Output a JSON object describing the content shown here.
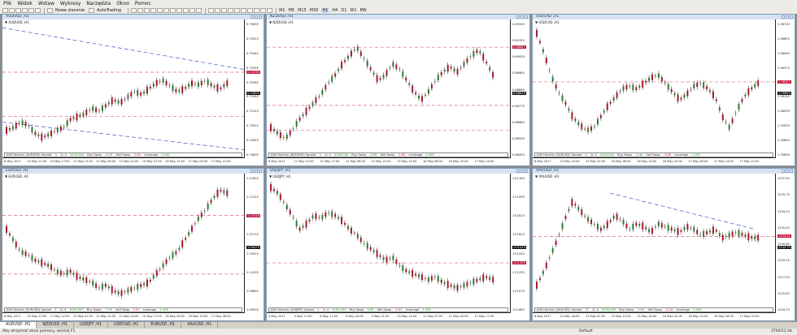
{
  "menu": [
    "Plik",
    "Widok",
    "Wstaw",
    "Wykresy",
    "Narzędzia",
    "Okno",
    "Pomoc"
  ],
  "toolbar": {
    "new_order": "Nowe zlecenie",
    "autotrading": "AutoTrading",
    "timeframes": [
      "M1",
      "M5",
      "M15",
      "M30",
      "H1",
      "H4",
      "D1",
      "W1",
      "MN"
    ],
    "active_timeframe": "H1"
  },
  "charts": [
    {
      "title": "AUDUSD ,H1",
      "symbol": "AUDUSD ,H1",
      "color": "#1a1a1a",
      "axis": [
        "0.75635",
        "0.75515",
        "0.75440",
        "0.75335",
        "0.75285",
        "0.75185",
        "0.75125",
        "0.75025",
        "0.74945",
        "0.74835"
      ],
      "price_tag": "0.74780",
      "price_tag2": "0.74905",
      "times": [
        "8 May 2017",
        "10 May 21:00",
        "10 May 17:00",
        "11 May 13:00",
        "12 May 09:00",
        "15 May 01:00",
        "15 May 21:00",
        "16 May 13:00",
        "17 May 09:00",
        "17 May 21:00"
      ],
      "info": {
        "label": "J&M Hendrix (AUDUSD)",
        "spread_l": "Spread",
        "spread_v": "4",
        "margin_l": "1L 4",
        "margin_v": "$100,000",
        "swap_buy_l": "Buy Swap",
        "swap_buy_v": "-0.25",
        "swap_sell_l": "Sell Swap",
        "swap_sell_v": "-0.20",
        "lev_l": "Leverage",
        "lev_v": "1:100"
      }
    },
    {
      "title": "NZDUSD ,H1",
      "symbol": "NZDUSD ,H1",
      "color": "#1a1a1a",
      "axis": [
        "0.69240",
        "0.69155",
        "0.69050",
        "0.68960",
        "0.68865",
        "0.68775",
        "0.68680",
        "0.68590",
        "0.68495"
      ],
      "price_tag": "0.68847",
      "price_tag2": "0.68610",
      "times": [
        "8 May 2017",
        "11 May 12:00",
        "11 May 17:00",
        "12 May 06:00",
        "12 May 22:00",
        "15 May 14:00",
        "16 May 06:00",
        "16 May 22:00",
        "17 May 14:00"
      ],
      "info": {
        "label": "J&M Hendrix (NZDUSD)",
        "spread_l": "Spread",
        "spread_v": "5",
        "margin_l": "1L 4",
        "margin_v": "$100,000",
        "swap_buy_l": "Buy Swap",
        "swap_buy_v": "-0.05",
        "swap_sell_l": "Sell Swap",
        "swap_sell_v": "-2.62",
        "lev_l": "Leverage",
        "lev_v": "1:100"
      }
    },
    {
      "title": "USDCAD ,H1",
      "symbol": "USDCAD ,H1",
      "color": "#1a1a1a",
      "axis": [
        "1.36720",
        "1.36605",
        "1.36490",
        "1.36375",
        "1.36260",
        "1.36145",
        "1.36035",
        "1.35920",
        "1.35805",
        "1.35690"
      ],
      "price_tag": "1.36357",
      "price_tag2": "1.35655",
      "times": [
        "8 May 2017",
        "15 May 10:00",
        "15 May 22:00",
        "16 May 06:00",
        "16 May 14:00",
        "16 May 22:00",
        "17 May 06:00",
        "17 May 14:00",
        "17 May 22:00"
      ],
      "info": {
        "label": "J&M Hendrix (USDCAD)",
        "spread_l": "Spread",
        "spread_v": "4",
        "margin_l": "1L 4",
        "margin_v": "$100,000",
        "swap_buy_l": "Buy Swap",
        "swap_buy_v": "-0.40",
        "swap_sell_l": "Sell Swap",
        "swap_sell_v": "-3.00",
        "lev_l": "Leverage",
        "lev_v": "1:100"
      }
    },
    {
      "title": "EURUSD ,H1",
      "symbol": "EURUSD ,H1",
      "color": "#1a1a1a",
      "axis": [
        "1.11620",
        "1.11315",
        "1.11015",
        "1.10710",
        "1.10410",
        "1.10105",
        "1.09805",
        "1.09500"
      ],
      "price_tag": "1.10728",
      "price_tag2": "1.09475",
      "times": [
        "8 May 2017",
        "10 May 23:00",
        "11 May 12:00",
        "12 May 01:00",
        "12 May 14:00",
        "15 May 04:00",
        "15 May 17:00",
        "16 May 06:00",
        "16 May 19:00",
        "17 May 08:00"
      ],
      "info": {
        "label": "J&M Hendrix (EURUSD)",
        "spread_l": "Spread",
        "spread_v": "3",
        "margin_l": "1L 4",
        "margin_v": "$100,000",
        "swap_buy_l": "Buy Swap",
        "swap_buy_v": "-7.50",
        "swap_sell_l": "Sell Swap",
        "swap_sell_v": "2.07",
        "lev_l": "Leverage",
        "lev_v": "1:100"
      }
    },
    {
      "title": "USDJPY ,H1",
      "symbol": "USDJPY ,H1",
      "color": "#1a1a1a",
      "axis": [
        "114.180",
        "113.995",
        "113.810",
        "113.625",
        "113.440",
        "113.255",
        "113.070",
        "112.885"
      ],
      "price_tag": "113.205",
      "price_tag2": "113.013",
      "times": [
        "4 May 2017",
        "5 May 17:00",
        "8 May 11:00",
        "9 May 04:00",
        "9 May 21:00",
        "10 May 14:00",
        "11 May 07:00",
        "12 May 00:00",
        "12 May 17:00"
      ],
      "info": {
        "label": "J&M Hendrix (USDJPY)",
        "spread_l": "Spread",
        "spread_v": "3",
        "margin_l": "1L 4",
        "margin_v": "$100,000",
        "swap_buy_l": "Buy Swap",
        "swap_buy_v": "0.00",
        "swap_sell_l": "Sell Swap",
        "swap_sell_v": "-0.41",
        "lev_l": "Leverage",
        "lev_v": "1:100"
      }
    },
    {
      "title": "XAUUSD ,H1",
      "symbol": "XAUUSD ,H1",
      "color": "#1a1a1a",
      "axis": [
        "1237.40",
        "1235.75",
        "1234.10",
        "1232.45",
        "1230.80",
        "1229.15",
        "1227.50",
        "1225.85",
        "1224.20"
      ],
      "price_tag": "1234.41",
      "price_tag2": "1233.70",
      "times": [
        "8 May 2017",
        "12 May 18:00",
        "15 May 02:00",
        "15 May 10:00",
        "15 May 18:00",
        "16 May 02:00",
        "16 May 10:00",
        "16 May 18:00",
        "17 May 02:00"
      ],
      "info": {
        "label": "J&M Hendrix (XAUUSD)",
        "spread_l": "Spread",
        "spread_v": "32",
        "margin_l": "1L 4",
        "margin_v": "$100,000",
        "swap_buy_l": "Buy Swap",
        "swap_buy_v": "-0.62",
        "swap_sell_l": "Sell Swap",
        "swap_sell_v": "-0.24",
        "lev_l": "Leverage",
        "lev_v": "1:100"
      }
    }
  ],
  "tabs": [
    "AUDUSD ,H1",
    "NZDUSD ,H1",
    "USDJPY ,H1",
    "USDCAD ,H1",
    "EURUSD ,H1",
    "XAUUSD ,H1"
  ],
  "active_tab": 0,
  "status": {
    "hint": "Aby otrzymać okno pomocy, wciśnij F1",
    "profile": "Default",
    "traffic": "3764/12 kb"
  },
  "colors": {
    "bull": "#2e7d32",
    "bear": "#a6192e",
    "level": "#e06080",
    "trend": "#4a4fc4"
  }
}
